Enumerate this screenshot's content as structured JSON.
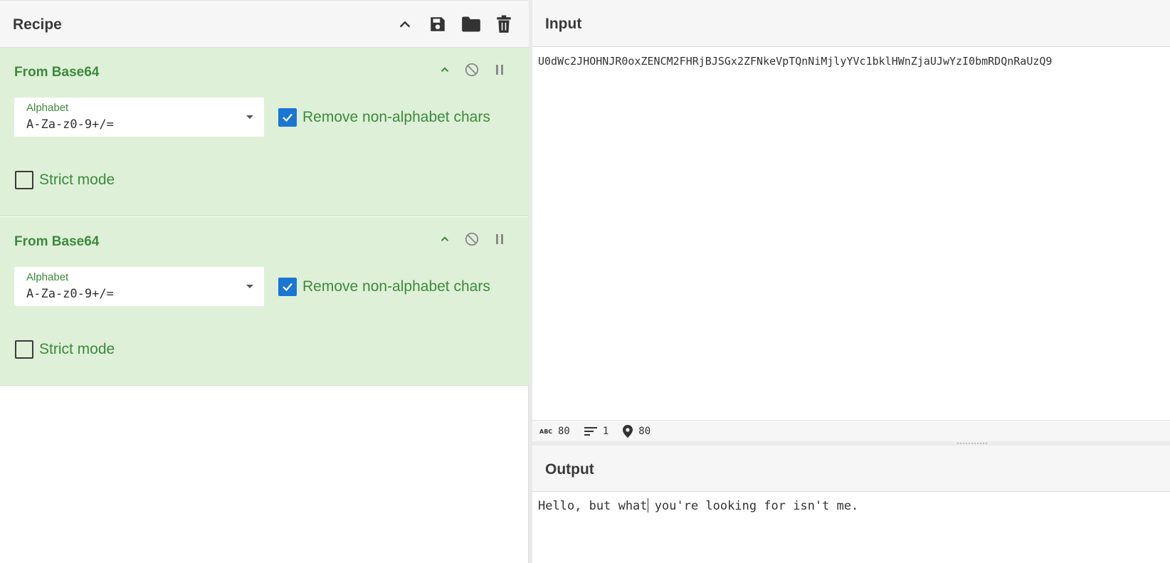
{
  "recipe": {
    "title": "Recipe",
    "icons": [
      "chevron-up-icon",
      "save-icon",
      "folder-icon",
      "trash-icon"
    ],
    "operations": [
      {
        "title": "From Base64",
        "alphabet_label": "Alphabet",
        "alphabet_value": "A-Za-z0-9+/=",
        "remove_non_alphabet": {
          "label": "Remove non-alphabet chars",
          "checked": true
        },
        "strict_mode": {
          "label": "Strict mode",
          "checked": false
        }
      },
      {
        "title": "From Base64",
        "alphabet_label": "Alphabet",
        "alphabet_value": "A-Za-z0-9+/=",
        "remove_non_alphabet": {
          "label": "Remove non-alphabet chars",
          "checked": true
        },
        "strict_mode": {
          "label": "Strict mode",
          "checked": false
        }
      }
    ]
  },
  "input": {
    "title": "Input",
    "text": "U0dWc2JHOHNJR0oxZENCM2FHRjBJSGx2ZFNkeVpTQnNiMjlyYVc1bklHWnZjaUJwYzI0bmRDQnRaUzQ9",
    "stats": {
      "length": "80",
      "lines": "1",
      "position": "80"
    }
  },
  "output": {
    "title": "Output",
    "text_before_caret": "Hello, but what",
    "text_after_caret": " you're looking for isn't me."
  },
  "colors": {
    "op_background": "#dff0d8",
    "op_title": "#3c8a3c",
    "checkbox_on": "#1976d2"
  }
}
